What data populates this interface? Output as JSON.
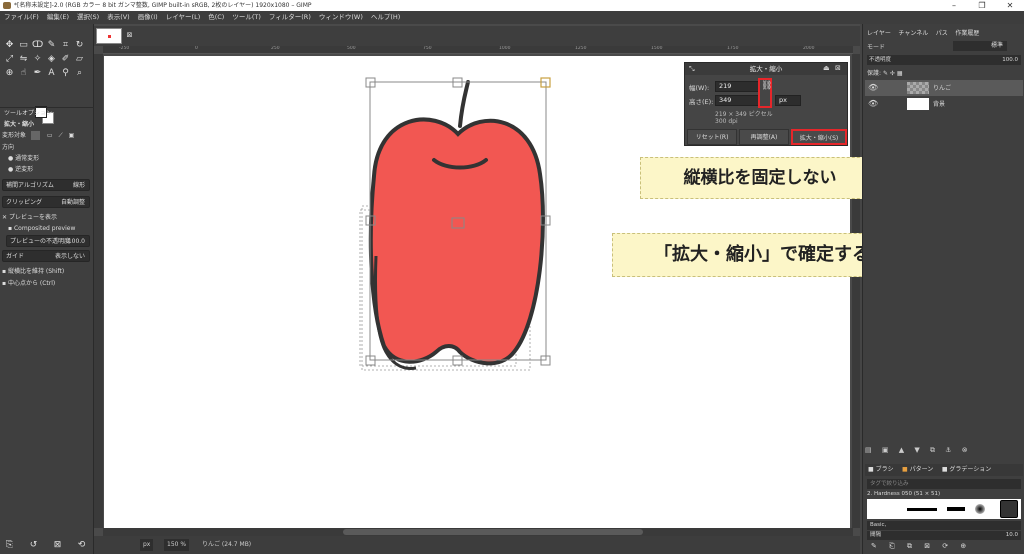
{
  "window": {
    "title": "*[名称未設定]-2.0 (RGB カラー 8 bit ガンマ整数, GIMP built-in sRGB, 2枚のレイヤー) 1920x1080 – GIMP",
    "minimize": "–",
    "restore": "❐",
    "close": "✕"
  },
  "menu": [
    "ファイル(F)",
    "編集(E)",
    "選択(S)",
    "表示(V)",
    "画像(I)",
    "レイヤー(L)",
    "色(C)",
    "ツール(T)",
    "フィルター(R)",
    "ウィンドウ(W)",
    "ヘルプ(H)"
  ],
  "ruler_ticks": [
    "-250",
    "0",
    "250",
    "500",
    "750",
    "1000",
    "1250",
    "1500",
    "1750",
    "2000"
  ],
  "tool_options": {
    "panel_tab": "ツールオプション",
    "tool_name": "拡大・縮小",
    "transform_label": "変形対象",
    "direction_label": "方向",
    "direction_forward": "通常変形",
    "direction_backward": "逆変形",
    "interpolation_label": "補間アルゴリズム",
    "interpolation_value": "線形",
    "clipping_label": "クリッピング",
    "clipping_value": "自動調整",
    "show_preview": "プレビューを表示",
    "composited_preview": "Composited preview",
    "preview_opacity_label": "プレビューの不透明度",
    "preview_opacity_value": "100.0",
    "guides_label": "ガイド",
    "guides_value": "表示しない",
    "keep_aspect": "縦横比を維持 (Shift)",
    "from_center": "中心点から (Ctrl)"
  },
  "scale_dialog": {
    "title": "拡大・縮小",
    "width_label": "幅(W):",
    "width_value": "219",
    "height_label": "高さ(E):",
    "height_value": "349",
    "unit": "px",
    "size_info": "219 × 349 ピクセル",
    "dpi_info": "300 dpi",
    "reset_button": "リセット(R)",
    "readjust_button": "再調整(A)",
    "scale_button": "拡大・縮小(S)"
  },
  "layers_panel": {
    "tabs": [
      "レイヤー",
      "チャンネル",
      "パス",
      "作業履歴"
    ],
    "mode_label": "モード",
    "mode_value": "標準",
    "opacity_label": "不透明度",
    "opacity_value": "100.0",
    "lock_label": "保護:",
    "layers": [
      {
        "name": "りんご",
        "visible": true
      },
      {
        "name": "背景",
        "visible": true
      }
    ]
  },
  "brushes_panel": {
    "tabs": [
      "ブラシ",
      "パターン",
      "グラデーション"
    ],
    "filter_placeholder": "タグで絞り込み",
    "brush_name": "2. Hardness 050 (51 × 51)",
    "preset": "Basic,",
    "spacing_label": "間隔",
    "spacing_value": "10.0"
  },
  "statusbar": {
    "unit": "px",
    "zoom": "150 %",
    "layer_info": "りんご (24.7 MB)"
  },
  "callouts": {
    "aspect": "縦横比を固定しない",
    "confirm": "「拡大・縮小」で確定する"
  },
  "colors": {
    "apple_red": "#f25752",
    "outline": "#333333",
    "highlight": "#e6262a",
    "callout_bg": "#fcf6c8"
  }
}
